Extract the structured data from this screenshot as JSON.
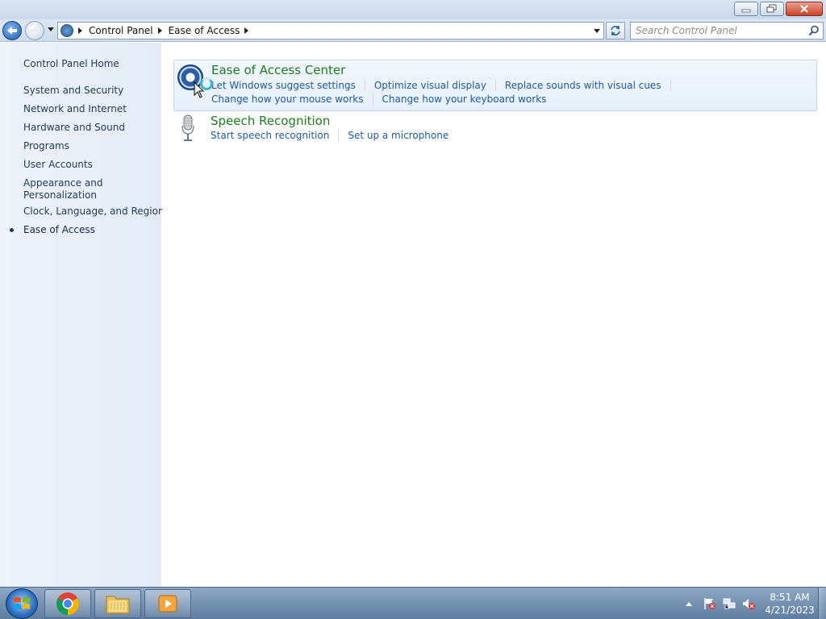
{
  "window": {
    "minimize_label": "Minimize",
    "maximize_label": "Restore",
    "close_label": "Close"
  },
  "address_bar": {
    "crumbs": [
      "Control Panel",
      "Ease of Access"
    ]
  },
  "search": {
    "placeholder": "Search Control Panel"
  },
  "sidebar": {
    "home": "Control Panel Home",
    "items": [
      "System and Security",
      "Network and Internet",
      "Hardware and Sound",
      "Programs",
      "User Accounts",
      "Appearance and Personalization",
      "Clock, Language, and Region",
      "Ease of Access"
    ],
    "appearance_line1": "Appearance and",
    "appearance_line2": "Personalization"
  },
  "categories": [
    {
      "title": "Ease of Access Center",
      "links_row1": [
        "Let Windows suggest settings",
        "Optimize visual display",
        "Replace sounds with visual cues"
      ],
      "links_row2": [
        "Change how your mouse works",
        "Change how your keyboard works"
      ]
    },
    {
      "title": "Speech Recognition",
      "links_row1": [
        "Start speech recognition",
        "Set up a microphone"
      ]
    }
  ],
  "taskbar": {
    "time": "8:51 AM",
    "date": "4/21/2023"
  },
  "colors": {
    "link": "#1e5aa0",
    "category_title": "#1e7b1e",
    "nav_text": "#1e395b"
  }
}
